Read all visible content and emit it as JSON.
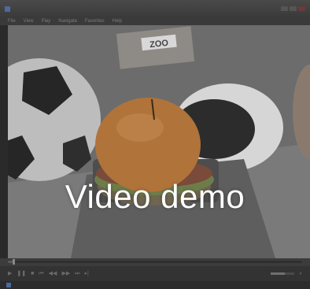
{
  "window": {
    "title": "",
    "icons": {
      "app": "media-player-icon",
      "minimize": "minimize-icon",
      "maximize": "maximize-icon",
      "close": "close-icon"
    }
  },
  "menu": {
    "items": [
      "File",
      "View",
      "Play",
      "Navigate",
      "Favorites",
      "Help"
    ]
  },
  "video": {
    "scene_sign": "ZOO"
  },
  "overlay": {
    "caption": "Video demo"
  },
  "playback": {
    "progress": 0.02,
    "volume": 0.6,
    "icons": {
      "play": "play-icon",
      "pause": "pause-icon",
      "stop": "stop-icon",
      "prev": "skip-back-icon",
      "rewind": "rewind-icon",
      "forward": "fast-forward-icon",
      "next": "skip-forward-icon",
      "frame_step": "frame-step-icon",
      "mute": "speaker-icon"
    }
  },
  "status": {
    "label": "",
    "time": ""
  },
  "colors": {
    "overlay_text": "#ffffff",
    "chrome": "#3a3a3a",
    "scene_tint": "#6e6e6e"
  }
}
